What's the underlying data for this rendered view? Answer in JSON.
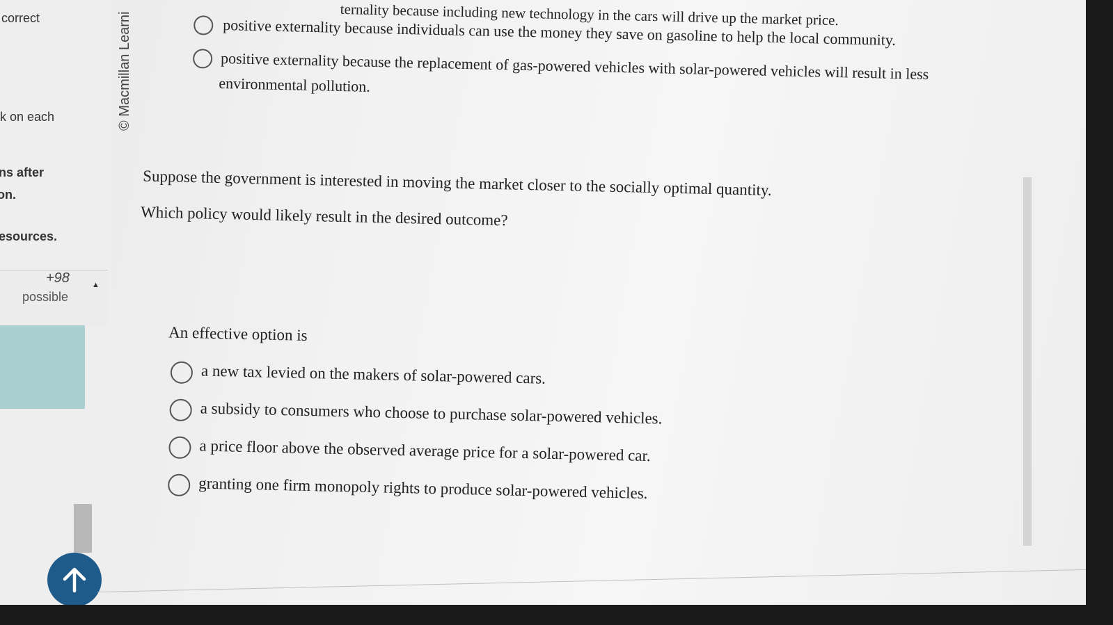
{
  "sidebar": {
    "fragments": [
      "correct",
      "k on each",
      "ns after",
      "on.",
      "esources."
    ],
    "points_value": "+98",
    "points_label": "possible"
  },
  "copyright": "© Macmillan Learni",
  "previous_question": {
    "option_partial": "ternality because including new technology in the cars will drive up the market price.",
    "options": [
      "positive externality because individuals can use the money they save on gasoline to help the local community.",
      "positive externality because the replacement of gas-powered vehicles with solar-powered vehicles will result in less"
    ],
    "option_continuation": "environmental pollution."
  },
  "question": {
    "line1": "Suppose the government is interested in moving the market closer to the socially optimal quantity.",
    "line2": "Which policy would likely result in the desired outcome?",
    "prompt": "An effective option is",
    "options": [
      "a new tax levied on the makers of solar-powered cars.",
      "a subsidy to consumers who choose to purchase solar-powered vehicles.",
      "a price floor above the observed average price for a solar-powered car.",
      "granting one firm monopoly rights to produce solar-powered vehicles."
    ]
  },
  "icons": {
    "scroll_top": "arrow-up-icon",
    "collapse": "caret-up-icon"
  },
  "colors": {
    "top_button": "#1f5b8a",
    "teal_block": "#a9cfd0"
  }
}
